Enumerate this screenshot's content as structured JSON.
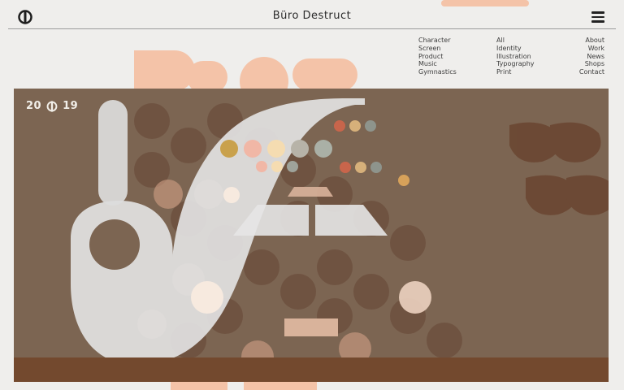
{
  "header": {
    "title": "Büro Destruct",
    "logo_icon": "bd-logo-icon",
    "menu_icon": "hamburger-menu-icon"
  },
  "nav": {
    "column_1": [
      "Character",
      "Screen",
      "Product",
      "Music",
      "Gymnastics"
    ],
    "column_2": [
      "All",
      "Identity",
      "Illustration",
      "Typography",
      "Print"
    ],
    "column_3": [
      "About",
      "Work",
      "News",
      "Shops",
      "Contact"
    ]
  },
  "hero": {
    "year_left": "20",
    "year_right": "19",
    "year_icon": "bd-logo-icon"
  },
  "colors": {
    "background": "#efeeec",
    "hero_brown": "#7c6552",
    "floor_brown": "#73492e",
    "salmon": "#f4c3a8",
    "light_gray": "#d9d9d9"
  }
}
